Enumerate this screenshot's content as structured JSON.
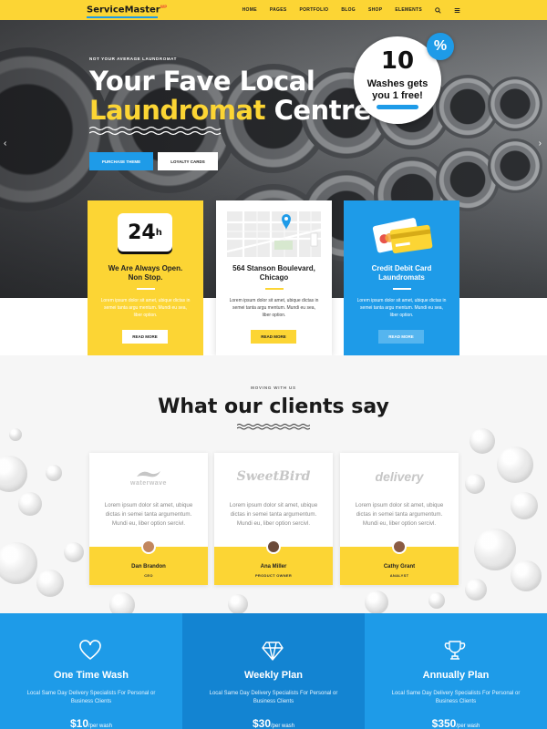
{
  "header": {
    "logo": "ServiceMaster",
    "logo_sup": "WP",
    "nav": [
      "HOME",
      "PAGES",
      "PORTFOLIO",
      "BLOG",
      "SHOP",
      "ELEMENTS"
    ]
  },
  "hero": {
    "eyebrow": "NOT YOUR AVERAGE LAUNDROMAT",
    "title_line1": "Your Fave Local",
    "title_highlight": "Laundromat",
    "title_rest": "Centre",
    "primary_button": "PURCHASE THEME",
    "secondary_button": "LOYALTY CARDS",
    "badge_number": "10",
    "badge_line1": "Washes gets",
    "badge_line2": "you 1 free!",
    "badge_percent": "%"
  },
  "features": [
    {
      "icon_text": "24",
      "icon_sup": "h",
      "title_line1": "We Are Always Open.",
      "title_line2": "Non Stop.",
      "text": "Lorem ipsum dolor sit amet, ubique dictas in semei tanta argu mentum. Mundi eu sea, liber option.",
      "button": "READ MORE"
    },
    {
      "title_line1": "564 Stanson Boulevard,",
      "title_line2": "Chicago",
      "text": "Lorem ipsum dolor sit amet, ubique dictas in semei tanta argu mentum. Mundi eu sea, liber option.",
      "button": "READ MORE"
    },
    {
      "title_line1": "Credit Debit Card",
      "title_line2": "Laundromats",
      "text": "Lorem ipsum dolor sit amet, ubique dictas in semei tanta argu mentum. Mundi eu sea, liber option.",
      "button": "READ MORE"
    }
  ],
  "testimonials": {
    "eyebrow": "MOVING WITH US",
    "title": "What our clients say",
    "items": [
      {
        "logo": "waterwave",
        "quote": "Lorem ipsum dolor sit amet, ubique dictas in semei tanta argumentum. Mundi eu, liber option sercivl.",
        "name": "Dan Brandon",
        "role": "CEO"
      },
      {
        "logo": "SweetBird",
        "quote": "Lorem ipsum dolor sit amet, ubique dictas in semei tanta argumentum. Mundi eu, liber option sercivl.",
        "name": "Ana Miller",
        "role": "PRODUCT OWNER"
      },
      {
        "logo": "delivery",
        "quote": "Lorem ipsum dolor sit amet, ubique dictas in semei tanta argumentum. Mundi eu, liber option sercivl.",
        "name": "Cathy Grant",
        "role": "ANALYST"
      }
    ]
  },
  "pricing": [
    {
      "icon": "heart-icon",
      "title": "One Time Wash",
      "desc": "Local Same Day Delivery Specialists For Personal or Business Clients",
      "price": "$10",
      "per": "/per wash"
    },
    {
      "icon": "diamond-icon",
      "title": "Weekly Plan",
      "desc": "Local Same Day Delivery Specialists For Personal or Business Clients",
      "price": "$30",
      "per": "/per wash"
    },
    {
      "icon": "trophy-icon",
      "title": "Annually Plan",
      "desc": "Local Same Day Delivery Specialists For Personal or Business Clients",
      "price": "$350",
      "per": "/per wash"
    }
  ],
  "colors": {
    "yellow": "#fcd534",
    "blue": "#1e9be8",
    "dark": "#1a1a1a"
  }
}
